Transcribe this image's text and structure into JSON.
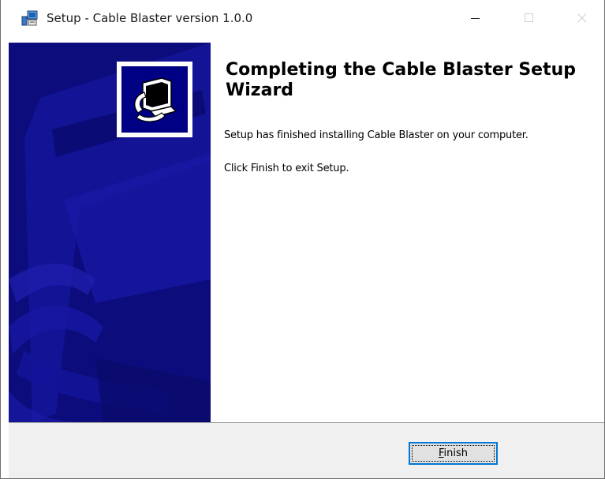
{
  "window": {
    "title": "Setup - Cable Blaster version 1.0.0",
    "icons": {
      "app": "setup-app-icon",
      "minimize": "minimize-icon",
      "maximize": "maximize-icon",
      "close": "close-icon",
      "logo": "computer-install-icon"
    }
  },
  "wizard": {
    "heading": "Completing the Cable Blaster Setup Wizard",
    "finished_text": "Setup has finished installing Cable Blaster on your computer.",
    "exit_text": "Click Finish to exit Setup."
  },
  "footer": {
    "finish_label_mnemonic": "F",
    "finish_label_rest": "inish"
  },
  "colors": {
    "banner": "#0c0c7c",
    "accent": "#0078d7",
    "footer": "#f0f0f0"
  }
}
